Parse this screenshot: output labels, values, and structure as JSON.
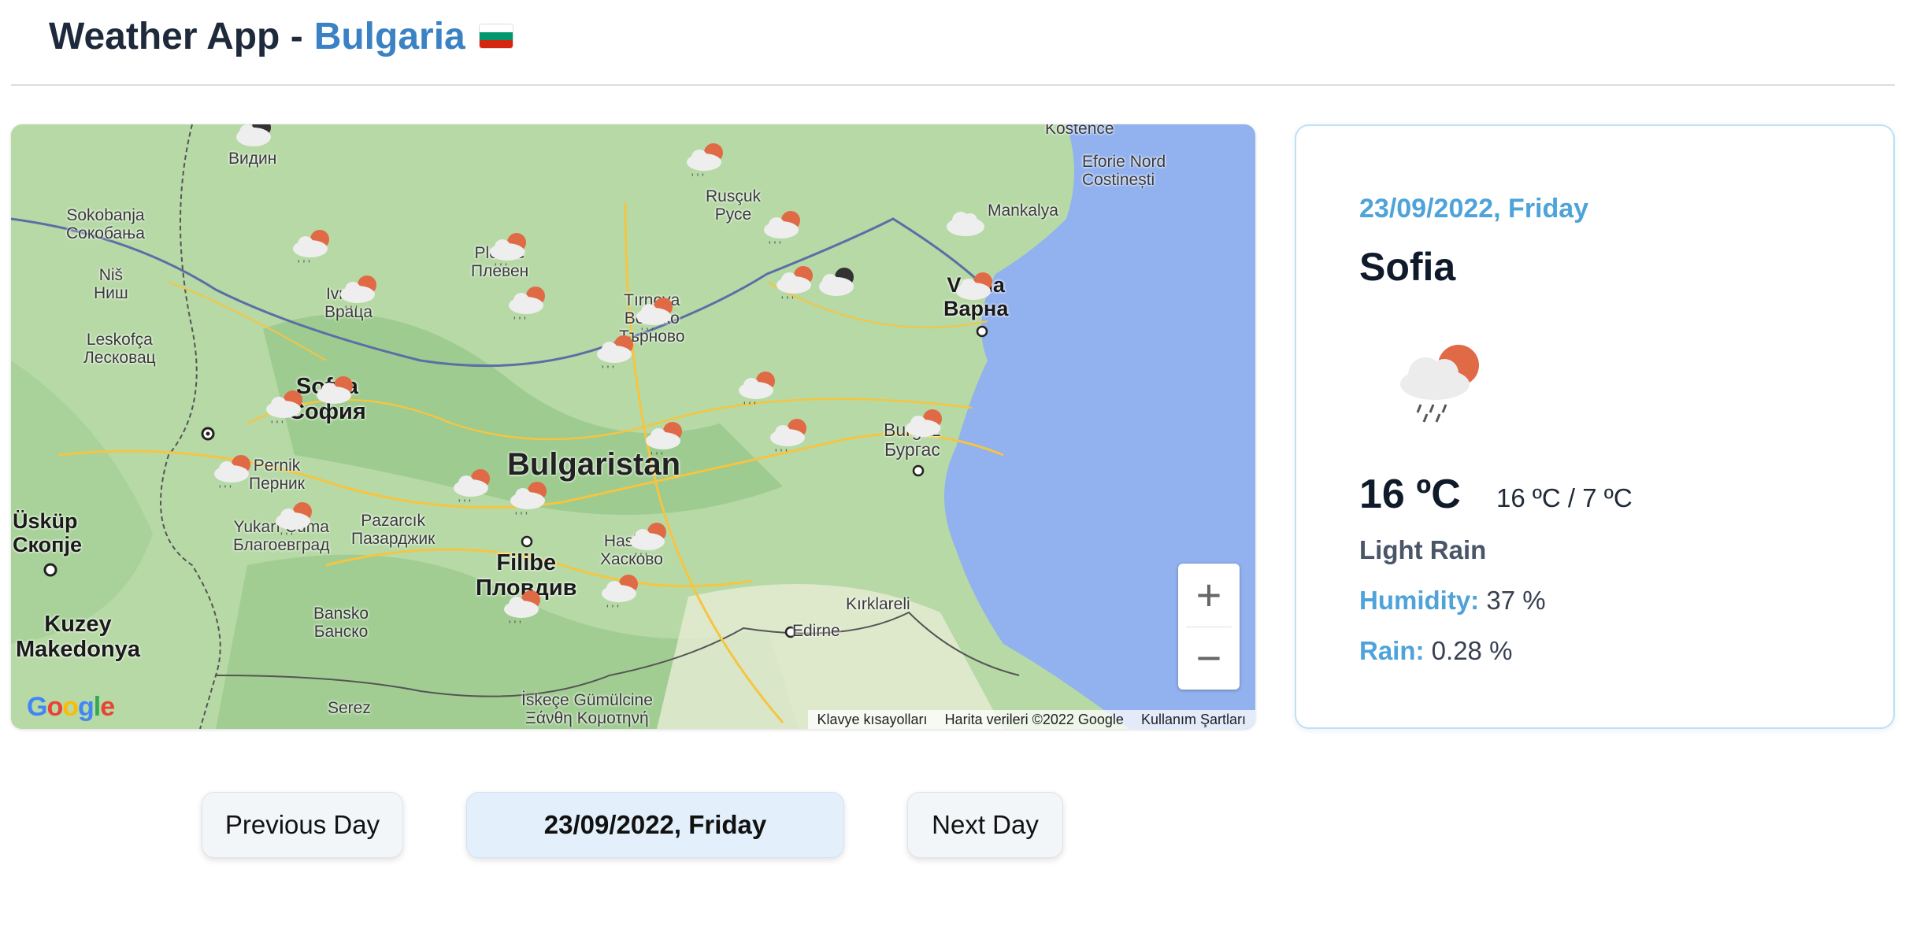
{
  "header": {
    "title": "Weather App - ",
    "country": "Bulgaria"
  },
  "map": {
    "country_label": "Bulgaristan",
    "places": [
      {
        "id": "vidin",
        "text": "Видин"
      },
      {
        "id": "sokobanja",
        "text": "Sokobanja\nСокобања"
      },
      {
        "id": "nis",
        "text": "Niš\nНиш"
      },
      {
        "id": "leskofca",
        "text": "Leskofça\nЛесковац"
      },
      {
        "id": "vratsa",
        "text": "Ivraca\nВраца"
      },
      {
        "id": "pleven",
        "text": "Plevne\nПлевен"
      },
      {
        "id": "ruse",
        "text": "Rusçuk\nРусе"
      },
      {
        "id": "tarnovo",
        "text": "Tırnova\nВелико\nТърново"
      },
      {
        "id": "varna",
        "text": "Varna\nВарна"
      },
      {
        "id": "kostence",
        "text": "Kostence"
      },
      {
        "id": "eforie",
        "text": "Eforie Nord\nCostinești"
      },
      {
        "id": "mankalya",
        "text": "Mankalya"
      },
      {
        "id": "sofia",
        "text": "Sofya\nСофия"
      },
      {
        "id": "pernik",
        "text": "Pernik\nПерник"
      },
      {
        "id": "uskup",
        "text": "Üsküp\nСкопје"
      },
      {
        "id": "kuzey",
        "text": "Kuzey\nMakedonya"
      },
      {
        "id": "yukarı",
        "text": "Yukarı Cuma\nБлагоевград"
      },
      {
        "id": "pazarcik",
        "text": "Pazarcık\nПазарджик"
      },
      {
        "id": "filibe",
        "text": "Filibe\nПловдив"
      },
      {
        "id": "haskovo",
        "text": "Hasköy\nХасково"
      },
      {
        "id": "burgas",
        "text": "Burgaz\nБургас"
      },
      {
        "id": "bansko",
        "text": "Bansko\nБанско"
      },
      {
        "id": "serez",
        "text": "Serez"
      },
      {
        "id": "kirklareli",
        "text": "Kırklareli"
      },
      {
        "id": "edirne",
        "text": "Edirne"
      },
      {
        "id": "iskece",
        "text": "İskeçe Gümülcine\nΞάνθη Κομοτηνή"
      }
    ],
    "footer": {
      "shortcuts": "Klavye kısayolları",
      "data": "Harita verileri ©2022 Google",
      "terms": "Kullanım Şartları"
    },
    "zoom_in": "+",
    "zoom_out": "−",
    "google": [
      "G",
      "o",
      "o",
      "g",
      "l",
      "e"
    ],
    "icons": [
      "cloud-rain-sun-icon",
      "cloud-storm-icon",
      "cloud-icon"
    ]
  },
  "card": {
    "date": "23/09/2022, Friday",
    "city": "Sofia",
    "icon": "cloud-rain-sun-icon",
    "temp": "16 ºC",
    "range": "16 ºC / 7 ºC",
    "description": "Light Rain",
    "humidity_label": "Humidity:",
    "humidity_value": "37 %",
    "rain_label": "Rain:",
    "rain_value": "0.28 %"
  },
  "nav": {
    "prev": "Previous Day",
    "current": "23/09/2022, Friday",
    "next": "Next Day"
  },
  "colors": {
    "accent": "#4ea3d9",
    "sea": "#91b1ef",
    "land": "#b6d9a6"
  }
}
